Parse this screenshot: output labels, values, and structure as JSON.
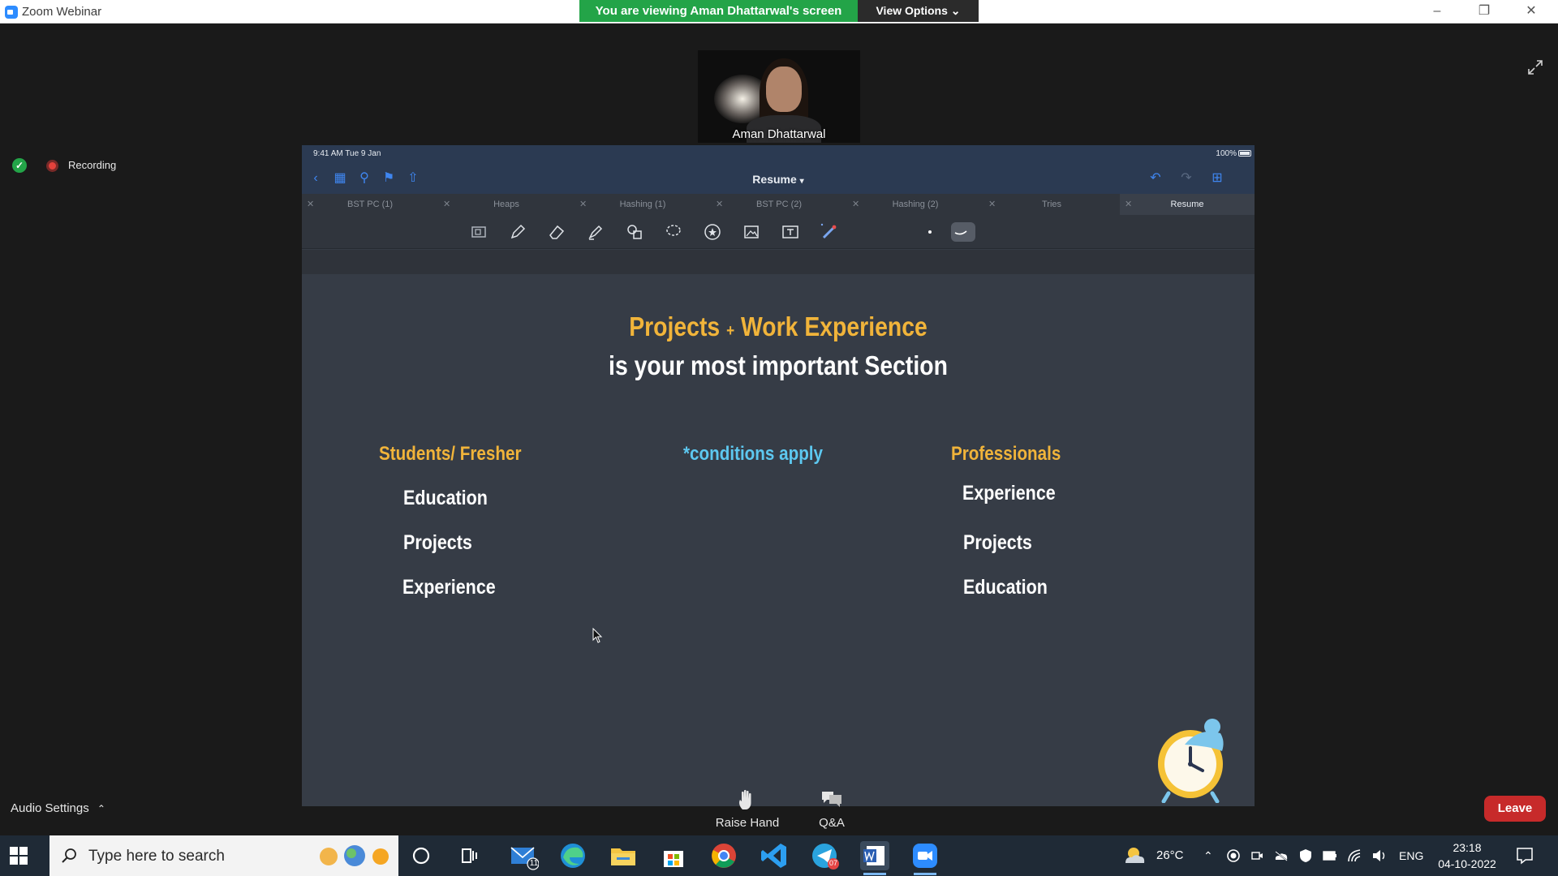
{
  "window": {
    "title": "Zoom Webinar",
    "banner": "You are viewing Aman Dhattarwal's screen",
    "view_options": "View Options",
    "recording": "Recording"
  },
  "speaker": {
    "name": "Aman Dhattarwal"
  },
  "ipad": {
    "time": "9:41 AM  Tue 9 Jan",
    "battery": "100%",
    "doc_title": "Resume",
    "tabs": [
      "BST PC (1)",
      "Heaps",
      "Hashing (1)",
      "BST PC (2)",
      "Hashing (2)",
      "Tries",
      "Resume"
    ],
    "active_tab": "Resume"
  },
  "slide": {
    "title_part1": "Projects",
    "title_plus": "+",
    "title_part2": "Work Experience",
    "title_line2": "is your most important Section",
    "left_heading": "Students/ Fresher",
    "middle_note": "*conditions apply",
    "right_heading": "Professionals",
    "left_items": [
      "Education",
      "Projects",
      "Experience"
    ],
    "right_items": [
      "Experience",
      "Projects",
      "Education"
    ]
  },
  "controls": {
    "audio_settings": "Audio Settings",
    "raise_hand": "Raise Hand",
    "qa": "Q&A",
    "leave": "Leave"
  },
  "taskbar": {
    "search_placeholder": "Type here to search",
    "mail_badge": "11",
    "telegram_badge": "07",
    "weather": "26°C",
    "language": "ENG",
    "time": "23:18",
    "date": "04-10-2022"
  },
  "colors": {
    "banner_green": "#23a448",
    "slide_yellow": "#f1b43a",
    "slide_cyan": "#5dc8f0",
    "leave_red": "#c72a2a",
    "goodnotes_blue": "#3f86f0"
  }
}
